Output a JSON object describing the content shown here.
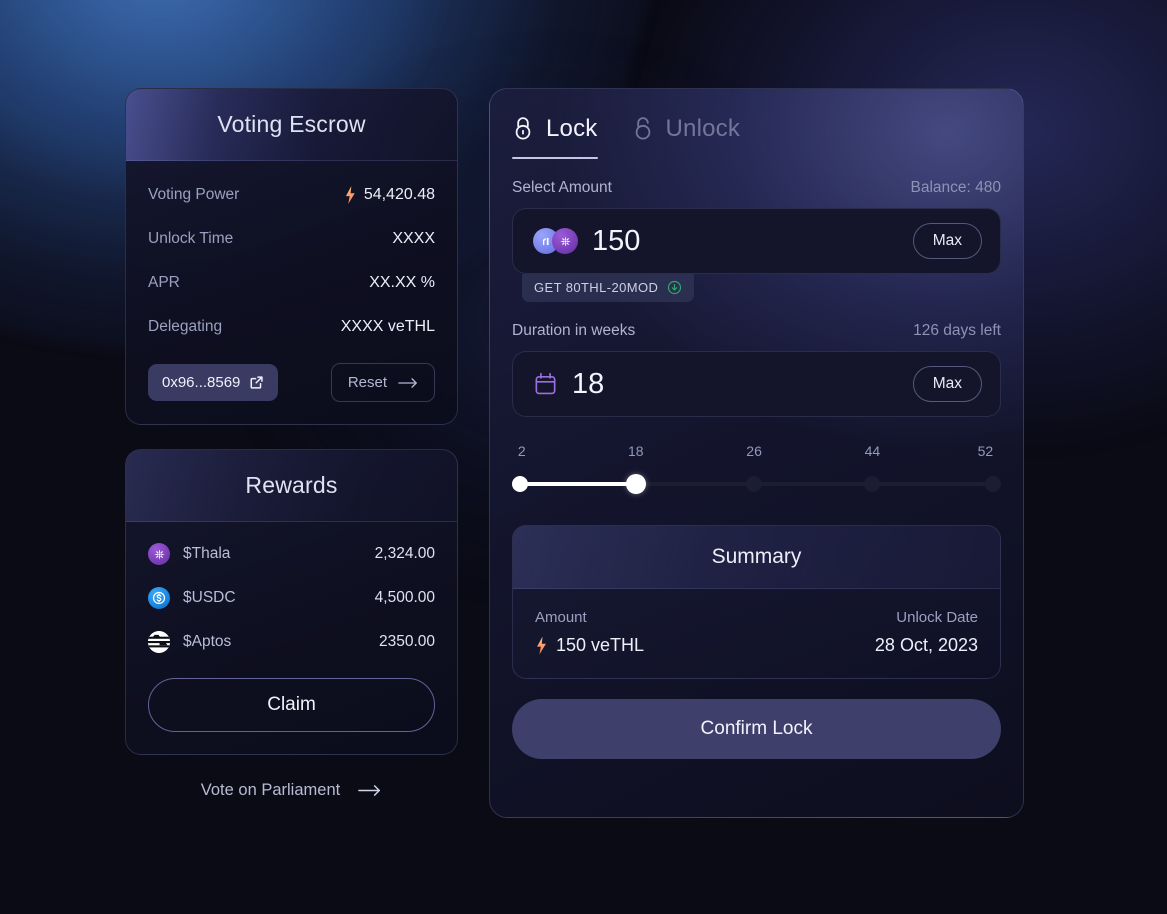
{
  "theme": {
    "background": "#0b0b16",
    "accent": "#3e3f6b",
    "accent_light": "#9a5bd6",
    "text_primary": "#f2f3fb",
    "text_muted": "#9ba0c0",
    "glow_blue": "#2e5696",
    "bolt_gradient_start": "#ffd089",
    "bolt_gradient_end": "#f4795e"
  },
  "voting_escrow": {
    "title": "Voting Escrow",
    "stats": [
      {
        "label": "Voting Power",
        "value": "54,420.48",
        "has_bolt": true
      },
      {
        "label": "Unlock Time",
        "value": "XXXX",
        "has_bolt": false
      },
      {
        "label": "APR",
        "value": "XX.XX %",
        "has_bolt": false
      },
      {
        "label": "Delegating",
        "value": "XXXX veTHL",
        "has_bolt": false
      }
    ],
    "address_button": "0x96...8569",
    "reset_button": "Reset"
  },
  "rewards": {
    "title": "Rewards",
    "items": [
      {
        "icon": "thala-token-icon",
        "name": "$Thala",
        "amount": "2,324.00"
      },
      {
        "icon": "usdc-token-icon",
        "name": "$USDC",
        "amount": "4,500.00"
      },
      {
        "icon": "aptos-token-icon",
        "name": "$Aptos",
        "amount": "2350.00"
      }
    ],
    "claim_button": "Claim"
  },
  "parliament_link": {
    "label": "Vote on Parliament",
    "icon": "arrow-right-icon"
  },
  "lock_panel": {
    "tabs": [
      {
        "label": "Lock",
        "icon": "lock-closed-icon",
        "active": true
      },
      {
        "label": "Unlock",
        "icon": "lock-open-icon",
        "active": false
      }
    ],
    "amount_section": {
      "label": "Select Amount",
      "balance_label": "Balance: 480",
      "value": "150",
      "max_button": "Max",
      "pair_icons": [
        "mod-token-icon",
        "thala-token-icon"
      ],
      "get_badge": "GET 80THL-20MOD",
      "get_badge_icon": "circle-arrow-down-icon"
    },
    "duration_section": {
      "label": "Duration in weeks",
      "days_left_label": "126 days left",
      "value": "18",
      "max_button": "Max",
      "icon": "calendar-icon"
    },
    "slider": {
      "ticks": [
        "2",
        "18",
        "26",
        "44",
        "52"
      ],
      "min": 2,
      "max": 52,
      "current": 18
    },
    "summary": {
      "title": "Summary",
      "amount_label": "Amount",
      "amount_value": "150 veTHL",
      "unlock_date_label": "Unlock Date",
      "unlock_date_value": "28 Oct, 2023"
    },
    "confirm_button": "Confirm Lock"
  }
}
